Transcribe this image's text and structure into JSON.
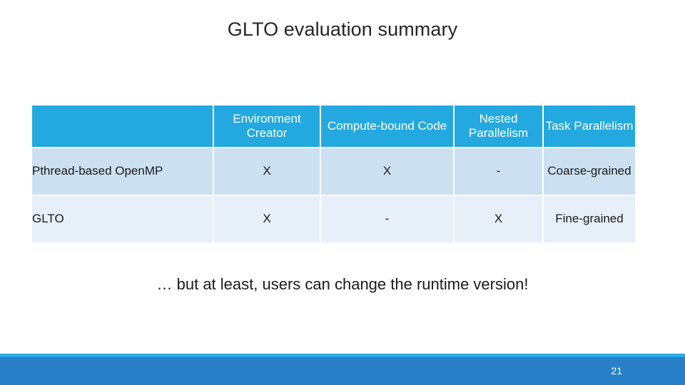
{
  "slide": {
    "title": "GLTO evaluation summary",
    "caption": "… but at least, users can change the runtime version!",
    "slide_number": "21"
  },
  "colors": {
    "header_fill": "#23A9E0",
    "row_a_fill": "#CCE0F2",
    "row_b_fill": "#E7EFF8",
    "footer_strip": "#29ABE2",
    "footer_band": "#2980C8",
    "header_text": "#FFFFFF",
    "body_text": "#1A1A1A",
    "gridline": "#FFFFFF"
  },
  "table": {
    "headers": [
      "",
      "Environment Creator",
      "Compute-bound Code",
      "Nested Parallelism",
      "Task Parallelism"
    ],
    "rows": [
      {
        "label": "Pthread-based OpenMP",
        "environment_creator": "X",
        "compute_bound_code": "X",
        "nested_parallelism": "-",
        "task_parallelism": "Coarse-grained"
      },
      {
        "label": "GLTO",
        "environment_creator": "X",
        "compute_bound_code": "-",
        "nested_parallelism": "X",
        "task_parallelism": "Fine-grained"
      }
    ]
  }
}
